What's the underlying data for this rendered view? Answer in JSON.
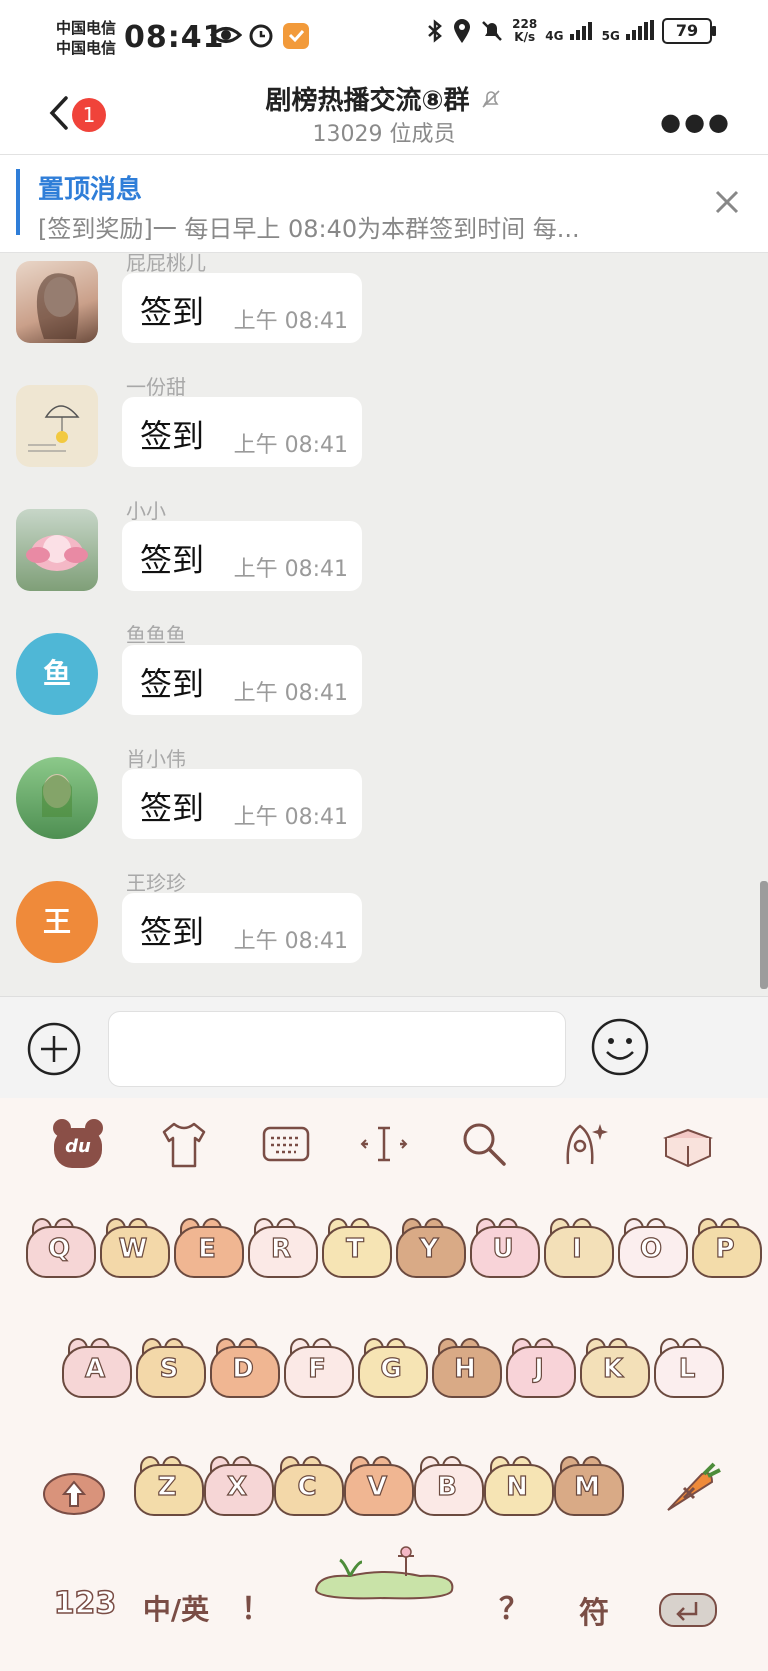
{
  "status_bar": {
    "carrier_top": "中国电信",
    "carrier_bottom": "中国电信",
    "time": "08:41",
    "net_speed": "228",
    "net_speed_unit": "K/s",
    "net_4g": "4G",
    "net_5g": "5G",
    "battery": "79"
  },
  "header": {
    "unread_count": "1",
    "title": "剧榜热播交流⑧群",
    "member_count": "13029 位成员"
  },
  "pinned": {
    "title": "置顶消息",
    "text": "[签到奖励]一 每日早上 08:40为本群签到时间  每..."
  },
  "messages": [
    {
      "sender": "屁屁桃儿",
      "text": "签到",
      "time": "上午  08:41",
      "avatar_letter": ""
    },
    {
      "sender": "一份甜",
      "text": "签到",
      "time": "上午  08:41",
      "avatar_letter": ""
    },
    {
      "sender": "小小",
      "text": "签到",
      "time": "上午  08:41",
      "avatar_letter": ""
    },
    {
      "sender": "鱼鱼鱼",
      "text": "签到",
      "time": "上午  08:41",
      "avatar_letter": "鱼"
    },
    {
      "sender": "肖小伟",
      "text": "签到",
      "time": "上午  08:41",
      "avatar_letter": ""
    },
    {
      "sender": "王珍珍",
      "text": "签到",
      "time": "上午  08:41",
      "avatar_letter": "王"
    }
  ],
  "input": {
    "value": "",
    "placeholder": ""
  },
  "keyboard": {
    "brand": "du",
    "row1": [
      "Q",
      "W",
      "E",
      "R",
      "T",
      "Y",
      "U",
      "I",
      "O",
      "P"
    ],
    "row2": [
      "A",
      "S",
      "D",
      "F",
      "G",
      "H",
      "J",
      "K",
      "L"
    ],
    "row3": [
      "Z",
      "X",
      "C",
      "V",
      "B",
      "N",
      "M"
    ],
    "num_key": "123",
    "lang_key": "中/英",
    "comma_key": "！",
    "question_key": "？",
    "symbol_key": "符"
  },
  "colors": {
    "accent_blue": "#2f7ed8",
    "badge_red": "#f0433a",
    "avatar_fish": "#4fb7d6",
    "avatar_wang": "#ef8a3a",
    "key_colors": [
      "#f6d6d6",
      "#f3d8a9",
      "#f0b692",
      "#fbe9e6",
      "#f6e4b4",
      "#d9aa86",
      "#f8d3d8",
      "#f3e0b8",
      "#fbeeee",
      "#f3dcaa"
    ]
  }
}
